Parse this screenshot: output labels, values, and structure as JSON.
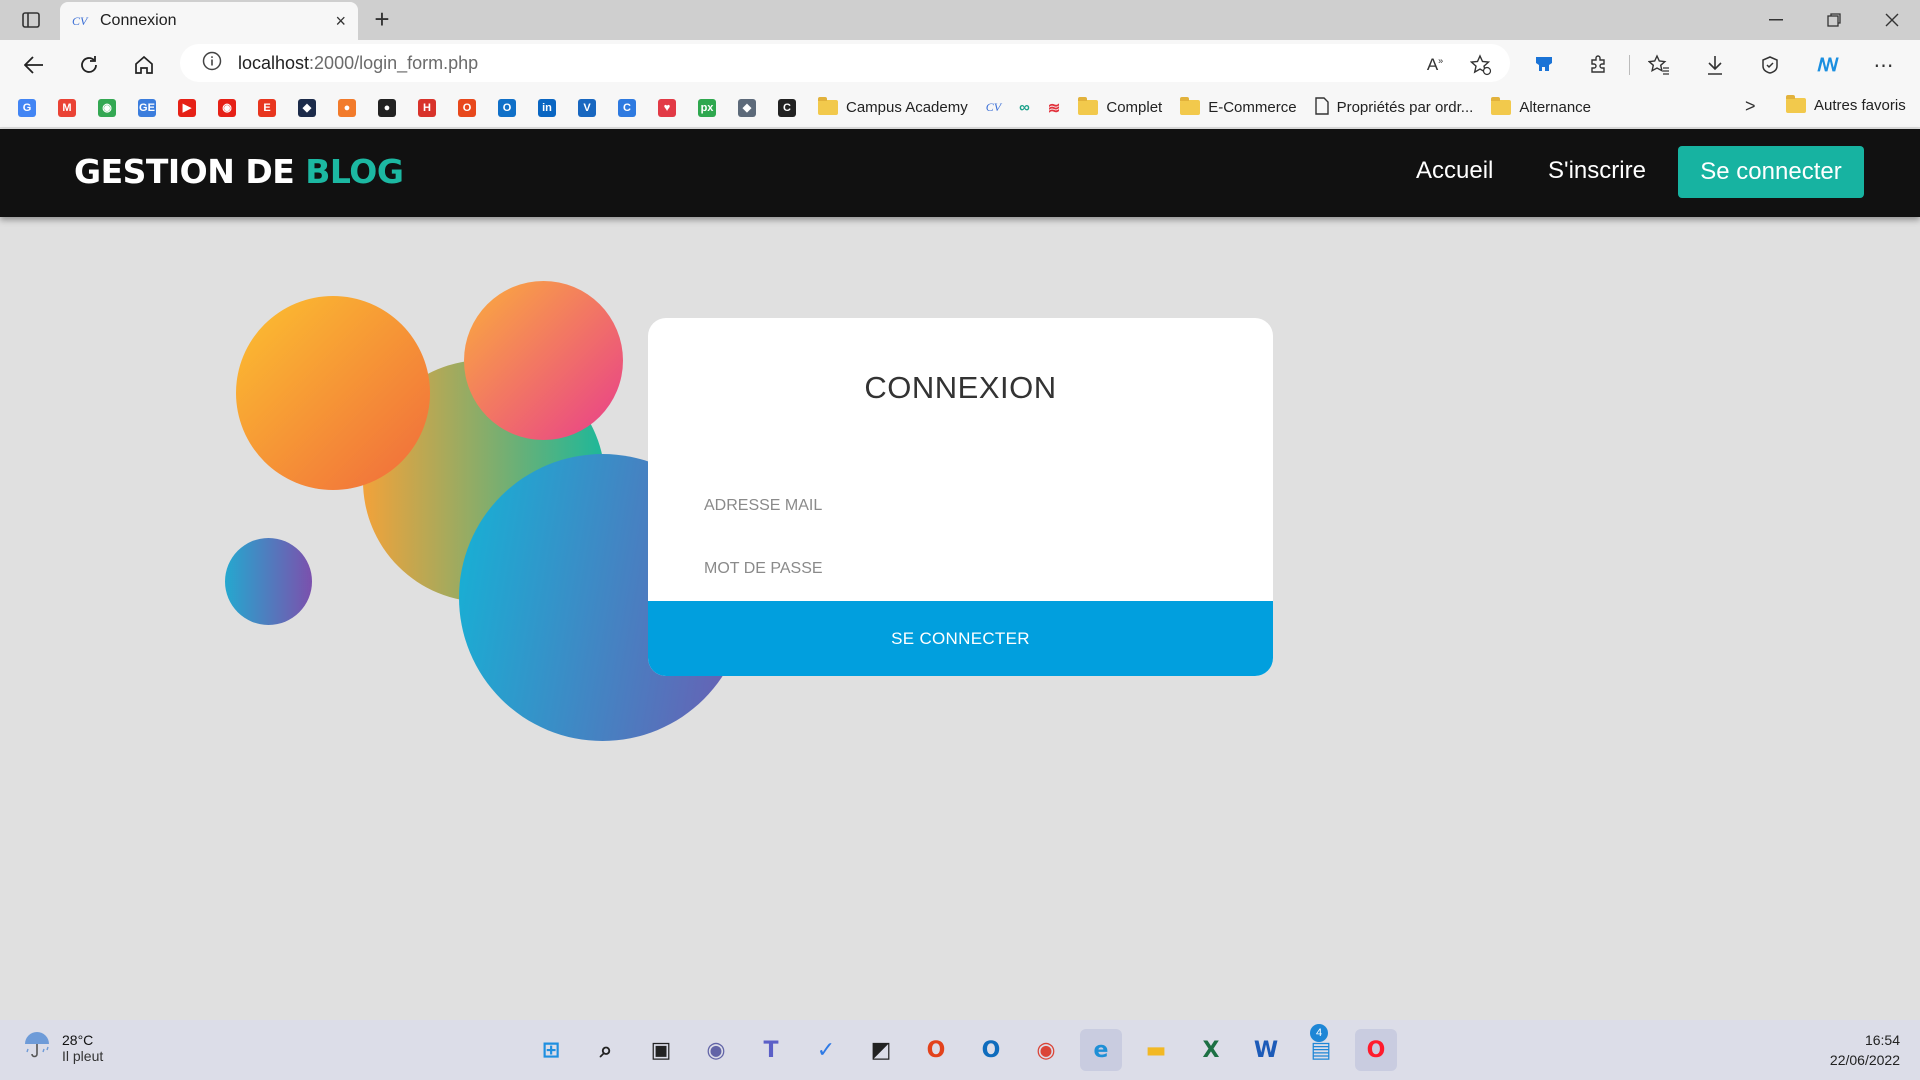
{
  "browser": {
    "tab_title": "Connexion",
    "tab_favicon_text": "CV",
    "new_tab_symbol": "+",
    "close_tab_symbol": "×",
    "url_host": "localhost",
    "url_rest": ":2000/login_form.php",
    "window_controls": [
      "minimize-icon",
      "restore-icon",
      "close-icon"
    ],
    "toolbar_icons": [
      "read-aloud-icon",
      "add-favorite-icon",
      "extension-shield-icon",
      "extensions-icon",
      "favorites-icon",
      "downloads-icon",
      "performance-icon",
      "copilot-icon",
      "more-icon"
    ]
  },
  "bookmarks": {
    "icon_items": [
      {
        "name": "google",
        "glyph": "G",
        "color": "#4285f4"
      },
      {
        "name": "gmail",
        "glyph": "M",
        "color": "#ea4335"
      },
      {
        "name": "maps",
        "glyph": "◉",
        "color": "#34a853"
      },
      {
        "name": "gestion",
        "glyph": "GE",
        "color": "#3b7ddd"
      },
      {
        "name": "youtube",
        "glyph": "▶",
        "color": "#e62117"
      },
      {
        "name": "youtube-music",
        "glyph": "◉",
        "color": "#e62117"
      },
      {
        "name": "te",
        "glyph": "E",
        "color": "#e8361f"
      },
      {
        "name": "prefect",
        "glyph": "◆",
        "color": "#1c2b4a"
      },
      {
        "name": "orange-app",
        "glyph": "●",
        "color": "#f27b2b"
      },
      {
        "name": "github",
        "glyph": "●",
        "color": "#222"
      },
      {
        "name": "h-app",
        "glyph": "H",
        "color": "#d8332b"
      },
      {
        "name": "office",
        "glyph": "O",
        "color": "#e8481c"
      },
      {
        "name": "outlook",
        "glyph": "O",
        "color": "#1070c8"
      },
      {
        "name": "linkedin",
        "glyph": "in",
        "color": "#0a66c2"
      },
      {
        "name": "vuetify",
        "glyph": "V",
        "color": "#1867c0"
      },
      {
        "name": "edge-c",
        "glyph": "C",
        "color": "#2e7ae0"
      },
      {
        "name": "heart-app",
        "glyph": "♥",
        "color": "#e23a46"
      },
      {
        "name": "px",
        "glyph": "px",
        "color": "#2fa84f"
      },
      {
        "name": "layers",
        "glyph": "◆",
        "color": "#5d6a7a"
      },
      {
        "name": "c-app",
        "glyph": "C",
        "color": "#222"
      }
    ],
    "text_items": [
      {
        "label": "Campus Academy",
        "type": "folder"
      },
      {
        "label": "",
        "type": "cv"
      },
      {
        "label": "",
        "type": "link"
      },
      {
        "label": "",
        "type": "swirl"
      },
      {
        "label": "Complet",
        "type": "folder"
      },
      {
        "label": "E-Commerce",
        "type": "folder"
      },
      {
        "label": "Propriétés par ordr...",
        "type": "page"
      },
      {
        "label": "Alternance",
        "type": "folder"
      }
    ],
    "more_symbol": ">",
    "other_favorites": "Autres favoris"
  },
  "site": {
    "brand_main": "GESTION DE ",
    "brand_accent": "BLOG",
    "nav_home": "Accueil",
    "nav_register": "S'inscrire",
    "nav_login": "Se connecter",
    "accent_color": "#17b3a1"
  },
  "login": {
    "title": "CONNEXION",
    "email_placeholder": "ADRESSE MAIL",
    "password_placeholder": "MOT DE PASSE",
    "submit_label": "SE CONNECTER",
    "button_color": "#019fde"
  },
  "taskbar": {
    "temperature": "28°C",
    "condition": "Il pleut",
    "time": "16:54",
    "date": "22/06/2022",
    "badge_count": "4",
    "apps": [
      {
        "name": "start",
        "glyph": "⊞",
        "color": "#1f8fe0"
      },
      {
        "name": "search",
        "glyph": "⌕",
        "color": "#222"
      },
      {
        "name": "task-view",
        "glyph": "▣",
        "color": "#222"
      },
      {
        "name": "chat",
        "glyph": "◉",
        "color": "#6264a7"
      },
      {
        "name": "teams",
        "glyph": "T",
        "color": "#5b5fc7"
      },
      {
        "name": "todo",
        "glyph": "✓",
        "color": "#2f7ae5"
      },
      {
        "name": "sticky-notes",
        "glyph": "◩",
        "color": "#222"
      },
      {
        "name": "office",
        "glyph": "O",
        "color": "#e3421c"
      },
      {
        "name": "outlook",
        "glyph": "O",
        "color": "#0f6cbd"
      },
      {
        "name": "chrome",
        "glyph": "◉",
        "color": "#db4437"
      },
      {
        "name": "edge",
        "glyph": "e",
        "color": "#1e8fd6"
      },
      {
        "name": "file-explorer",
        "glyph": "▬",
        "color": "#f2b824"
      },
      {
        "name": "excel",
        "glyph": "X",
        "color": "#1d7044"
      },
      {
        "name": "word",
        "glyph": "W",
        "color": "#1d5bb8"
      },
      {
        "name": "store",
        "glyph": "▤",
        "color": "#1e86d6"
      },
      {
        "name": "opera",
        "glyph": "O",
        "color": "#ff1b2d"
      }
    ]
  }
}
